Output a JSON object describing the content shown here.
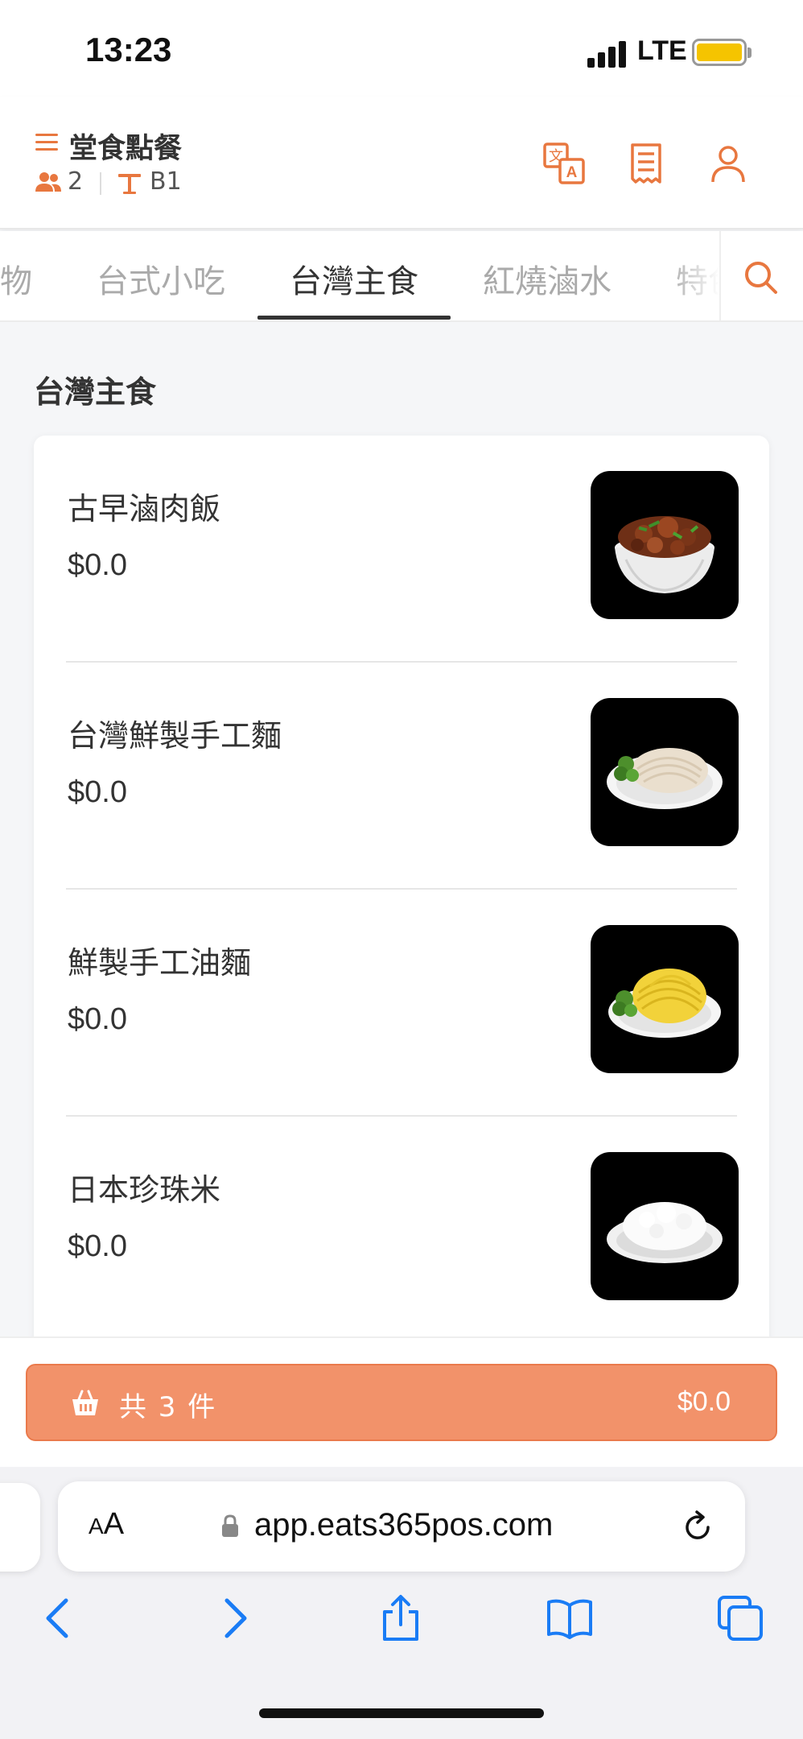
{
  "status_bar": {
    "time": "13:23",
    "network": "LTE"
  },
  "header": {
    "title": "堂食點餐",
    "guests": "2",
    "table": "B1"
  },
  "tabs": {
    "items": [
      "物",
      "台式小吃",
      "台灣主食",
      "紅燒滷水",
      "特色"
    ],
    "active_index": 2
  },
  "section": {
    "title": "台灣主食"
  },
  "menu_items": [
    {
      "name": "古早滷肉飯",
      "price": "$0.0",
      "image_icon": "braised-pork-rice-icon"
    },
    {
      "name": "台灣鮮製手工麵",
      "price": "$0.0",
      "image_icon": "handmade-noodles-icon"
    },
    {
      "name": "鮮製手工油麵",
      "price": "$0.0",
      "image_icon": "yellow-oil-noodles-icon"
    },
    {
      "name": "日本珍珠米",
      "price": "$0.0",
      "image_icon": "white-rice-icon"
    }
  ],
  "cart": {
    "label": "共 3 件",
    "total": "$0.0"
  },
  "browser": {
    "aa_large": "A",
    "aa_small": "A",
    "url": "app.eats365pos.com"
  },
  "colors": {
    "accent": "#e8773f",
    "cart_bg": "#f2926a",
    "ios_blue": "#1a7cf5"
  }
}
